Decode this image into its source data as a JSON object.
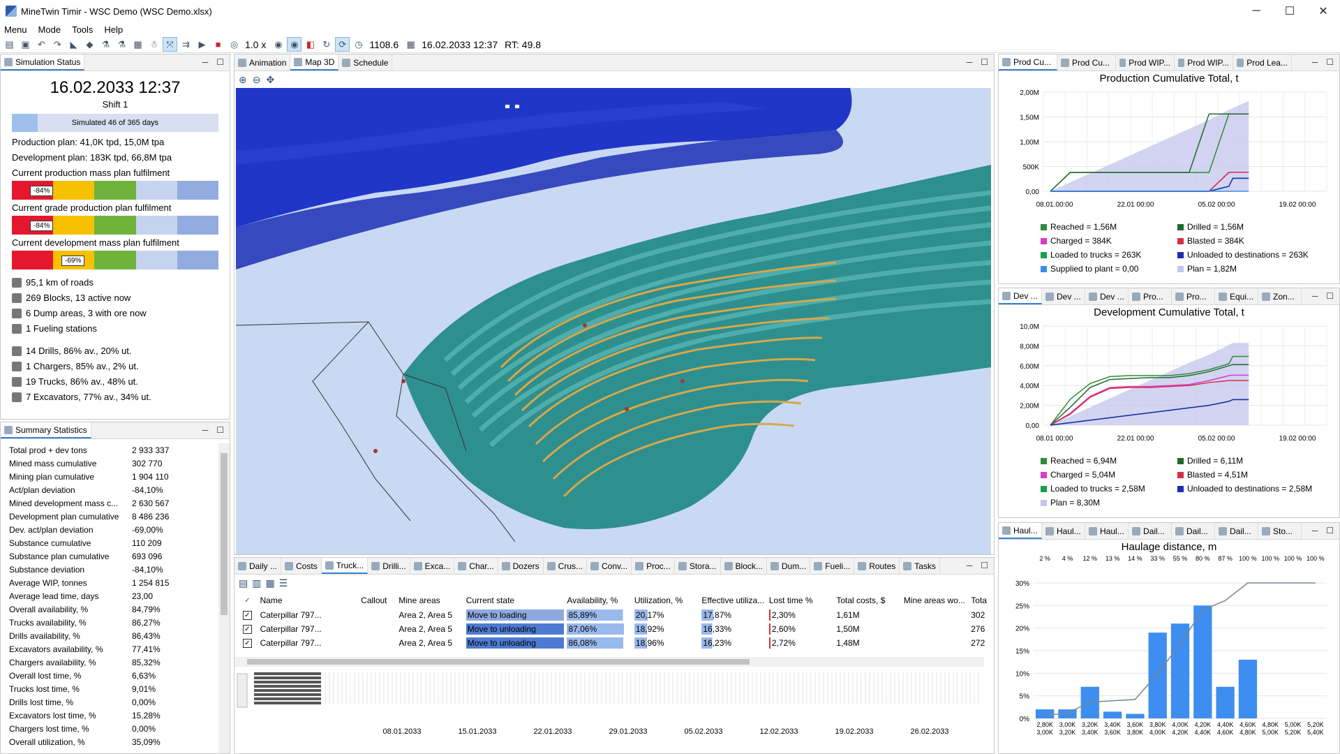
{
  "window": {
    "title": "MineTwin Timir - WSC Demo (WSC Demo.xlsx)"
  },
  "menu": [
    "Menu",
    "Mode",
    "Tools",
    "Help"
  ],
  "toolbar": {
    "speed": "1.0 x",
    "time_value": "1108.6",
    "datetime": "16.02.2033 12:37",
    "rt": "RT: 49.8"
  },
  "sim_status": {
    "tab": "Simulation Status",
    "date": "16.02.2033 12:37",
    "shift": "Shift 1",
    "simulated": "Simulated 46 of 365 days",
    "simulated_fraction": 0.126,
    "prod_plan": "Production plan: 41,0K tpd, 15,0M tpa",
    "dev_plan": "Development plan: 183K tpd, 66,8M tpa",
    "fulfilments": [
      {
        "label": "Current production mass plan fulfilment",
        "badge": "-84%",
        "fraction": 0.16
      },
      {
        "label": "Current grade production plan fulfilment",
        "badge": "-84%",
        "fraction": 0.16
      },
      {
        "label": "Current development mass plan fulfilment",
        "badge": "-69%",
        "fraction": 0.31
      }
    ],
    "infrastructure": [
      "95,1 km of roads",
      "269 Blocks, 13 active now",
      "6 Dump areas, 3 with ore now",
      "1 Fueling stations"
    ],
    "equipment": [
      "14 Drills, 86% av., 20% ut.",
      "1 Chargers, 85% av., 2% ut.",
      "19 Trucks, 86% av., 48% ut.",
      "7 Excavators, 77% av., 34% ut."
    ]
  },
  "summary": {
    "tab": "Summary Statistics",
    "rows": [
      [
        "Total prod + dev tons",
        "2 933 337"
      ],
      [
        "Mined mass cumulative",
        "302 770"
      ],
      [
        "Mining plan cumulative",
        "1 904 110"
      ],
      [
        "Act/plan deviation",
        "-84,10%"
      ],
      [
        "Mined development mass c...",
        "2 630 567"
      ],
      [
        "Development plan cumulative",
        "8 486 236"
      ],
      [
        "Dev. act/plan deviation",
        "-69,00%"
      ],
      [
        "Substance cumulative",
        "110 209"
      ],
      [
        "Substance plan cumulative",
        "693 096"
      ],
      [
        "Substance deviation",
        "-84,10%"
      ],
      [
        "Average WIP, tonnes",
        "1 254 815"
      ],
      [
        "Average lead time, days",
        "23,00"
      ],
      [
        "Overall availability, %",
        "84,79%"
      ],
      [
        "Trucks availability, %",
        "86,27%"
      ],
      [
        "Drills availability, %",
        "86,43%"
      ],
      [
        "Excavators availability, %",
        "77,41%"
      ],
      [
        "Chargers availability, %",
        "85,32%"
      ],
      [
        "Overall lost time, %",
        "6,63%"
      ],
      [
        "Trucks lost time, %",
        "9,01%"
      ],
      [
        "Drills lost time, %",
        "0,00%"
      ],
      [
        "Excavators lost time, %",
        "15,28%"
      ],
      [
        "Chargers lost time, %",
        "0,00%"
      ],
      [
        "Overall utilization, %",
        "35,09%"
      ]
    ]
  },
  "center_tabs": [
    "Animation",
    "Map 3D",
    "Schedule"
  ],
  "bottom_tabs": [
    "Daily ...",
    "Costs",
    "Truck...",
    "Drilli...",
    "Exca...",
    "Char...",
    "Dozers",
    "Crus...",
    "Conv...",
    "Proc...",
    "Stora...",
    "Block...",
    "Dum...",
    "Fueli...",
    "Routes",
    "Tasks"
  ],
  "truck_grid": {
    "columns": [
      "Name",
      "Callout",
      "Mine areas",
      "Current state",
      "Availability, %",
      "Utilization, %",
      "Effective utiliza...",
      "Lost time %",
      "Total costs, $",
      "Mine areas wo...",
      "Tota"
    ],
    "rows": [
      {
        "name": "Caterpillar 797...",
        "callout": "",
        "areas": "Area 2, Area 5",
        "state": "Move to loading",
        "avail": "85,89%",
        "avail_f": 0.859,
        "util": "20,17%",
        "util_f": 0.2017,
        "eff": "17,87%",
        "eff_f": 0.1787,
        "lost": "2,30%",
        "cost": "1,61M",
        "wo": "",
        "tot": "302"
      },
      {
        "name": "Caterpillar 797...",
        "callout": "",
        "areas": "Area 2, Area 5",
        "state": "Move to unloading",
        "avail": "87,06%",
        "avail_f": 0.8706,
        "util": "18,92%",
        "util_f": 0.1892,
        "eff": "16,33%",
        "eff_f": 0.1633,
        "lost": "2,60%",
        "cost": "1,50M",
        "wo": "",
        "tot": "276"
      },
      {
        "name": "Caterpillar 797...",
        "callout": "",
        "areas": "Area 2, Area 5",
        "state": "Move to unloading",
        "avail": "86,08%",
        "avail_f": 0.8608,
        "util": "18,96%",
        "util_f": 0.1896,
        "eff": "16,23%",
        "eff_f": 0.1623,
        "lost": "2,72%",
        "cost": "1,48M",
        "wo": "",
        "tot": "272"
      }
    ]
  },
  "gantt_dates": [
    "08.01.2033",
    "15.01.2033",
    "22.01.2033",
    "29.01.2033",
    "05.02.2033",
    "12.02.2033",
    "19.02.2033",
    "26.02.2033"
  ],
  "right_top_tabs": [
    "Prod Cu...",
    "Prod Cu...",
    "Prod WIP...",
    "Prod WIP...",
    "Prod Lea..."
  ],
  "right_mid_tabs": [
    "Dev ...",
    "Dev ...",
    "Dev ...",
    "Pro...",
    "Pro...",
    "Equi...",
    "Zon..."
  ],
  "right_bot_tabs": [
    "Haul...",
    "Haul...",
    "Haul...",
    "Dail...",
    "Dail...",
    "Dail...",
    "Sto..."
  ],
  "chart_data": [
    {
      "type": "line",
      "title": "Production Cumulative Total, t",
      "x_ticks": [
        "08.01.00:00",
        "22.01 00:00",
        "05.02 00:00",
        "19.02 00:00"
      ],
      "y_ticks": [
        "0,00",
        "500K",
        "1,00M",
        "1,50M",
        "2,00M"
      ],
      "ylim": [
        0,
        2000000
      ],
      "x": [
        0,
        5,
        10,
        15,
        20,
        25,
        30,
        35,
        40,
        45,
        46,
        50
      ],
      "series": [
        {
          "name": "Reached = 1,56M",
          "color": "#2e8b3a",
          "values": [
            0,
            380000,
            380000,
            380000,
            380000,
            380000,
            380000,
            380000,
            380000,
            1560000,
            1560000,
            1560000
          ]
        },
        {
          "name": "Drilled = 1,56M",
          "color": "#1e6a2a",
          "values": [
            0,
            380000,
            380000,
            380000,
            380000,
            380000,
            380000,
            380000,
            1560000,
            1560000,
            1560000,
            1560000
          ]
        },
        {
          "name": "Charged = 384K",
          "color": "#d63cc8",
          "values": [
            0,
            0,
            0,
            0,
            0,
            0,
            0,
            0,
            0,
            380000,
            384000,
            384000
          ]
        },
        {
          "name": "Blasted = 384K",
          "color": "#d43049",
          "values": [
            0,
            0,
            0,
            0,
            0,
            0,
            0,
            0,
            0,
            384000,
            384000,
            384000
          ]
        },
        {
          "name": "Loaded to trucks = 263K",
          "color": "#16a34a",
          "values": [
            0,
            0,
            0,
            0,
            0,
            0,
            0,
            0,
            0,
            100000,
            263000,
            263000
          ]
        },
        {
          "name": "Unloaded to destinations = 263K",
          "color": "#1b2fb0",
          "values": [
            0,
            0,
            0,
            0,
            0,
            0,
            0,
            0,
            0,
            100000,
            263000,
            263000
          ]
        },
        {
          "name": "Supplied to plant = 0,00",
          "color": "#3a8ee6",
          "values": [
            0,
            0,
            0,
            0,
            0,
            0,
            0,
            0,
            0,
            0,
            0,
            0
          ]
        },
        {
          "name": "Plan = 1,82M",
          "color": "#c3c6ec",
          "values": [
            0,
            180000,
            360000,
            540000,
            720000,
            900000,
            1080000,
            1260000,
            1440000,
            1640000,
            1680000,
            1820000
          ]
        }
      ]
    },
    {
      "type": "line",
      "title": "Development Cumulative Total, t",
      "x_ticks": [
        "08.01 00:00",
        "22.01 00:00",
        "05.02 00:00",
        "19.02 00:00"
      ],
      "y_ticks": [
        "0,00",
        "2,00M",
        "4,00M",
        "6,00M",
        "8,00M",
        "10,0M"
      ],
      "ylim": [
        0,
        10000000
      ],
      "x": [
        0,
        5,
        10,
        15,
        20,
        25,
        30,
        35,
        40,
        45,
        46,
        50
      ],
      "series": [
        {
          "name": "Reached = 6,94M",
          "color": "#2e8b3a",
          "values": [
            0,
            2600000,
            4200000,
            4900000,
            5000000,
            5000000,
            5000000,
            5200000,
            5600000,
            6200000,
            6940000,
            6940000
          ]
        },
        {
          "name": "Drilled = 6,11M",
          "color": "#1e6a2a",
          "values": [
            0,
            1800000,
            3800000,
            4600000,
            4700000,
            4800000,
            4800000,
            5000000,
            5400000,
            6000000,
            6110000,
            6110000
          ]
        },
        {
          "name": "Charged = 5,04M",
          "color": "#d63cc8",
          "values": [
            0,
            1200000,
            2900000,
            3800000,
            3900000,
            3900000,
            4000000,
            4100000,
            4500000,
            5000000,
            5040000,
            5040000
          ]
        },
        {
          "name": "Blasted = 4,51M",
          "color": "#d43049",
          "values": [
            0,
            1100000,
            2800000,
            3700000,
            3800000,
            3800000,
            3900000,
            4000000,
            4300000,
            4500000,
            4510000,
            4510000
          ]
        },
        {
          "name": "Loaded to trucks = 2,58M",
          "color": "#16a34a",
          "values": [
            0,
            250000,
            500000,
            750000,
            1000000,
            1250000,
            1500000,
            1750000,
            2000000,
            2400000,
            2580000,
            2580000
          ]
        },
        {
          "name": "Unloaded to destinations = 2,58M",
          "color": "#1b2fb0",
          "values": [
            0,
            250000,
            500000,
            750000,
            1000000,
            1250000,
            1500000,
            1750000,
            2000000,
            2400000,
            2580000,
            2580000
          ]
        },
        {
          "name": "Plan = 8,30M",
          "color": "#c3c6ec",
          "values": [
            0,
            900000,
            1800000,
            2700000,
            3600000,
            4500000,
            5400000,
            6300000,
            7100000,
            8100000,
            8300000,
            8300000
          ]
        }
      ]
    },
    {
      "type": "bar",
      "title": "Haulage distance, m",
      "categories_top": [
        "2,80K",
        "3,00K",
        "3,20K",
        "3,40K",
        "3,60K",
        "3,80K",
        "4,00K",
        "4,20K",
        "4,40K",
        "4,60K",
        "4,80K",
        "5,00K",
        "5,20K"
      ],
      "categories_bottom": [
        "3,00K",
        "3,20K",
        "3,40K",
        "3,60K",
        "3,80K",
        "4,00K",
        "4,20K",
        "4,40K",
        "4,60K",
        "4,80K",
        "5,00K",
        "5,20K",
        "5,40K"
      ],
      "cumulative_labels": [
        "2 %",
        "4 %",
        "12 %",
        "13 %",
        "14 %",
        "33 %",
        "55 %",
        "80 %",
        "87 %",
        "100 %",
        "100 %",
        "100 %",
        "100 %"
      ],
      "values": [
        2,
        2,
        7,
        1.5,
        1,
        19,
        21,
        25,
        7,
        13,
        0,
        0,
        0
      ],
      "cumulative": [
        2,
        4,
        12,
        13,
        14,
        33,
        55,
        80,
        87,
        100,
        100,
        100,
        100
      ],
      "y_ticks": [
        "0%",
        "5%",
        "10%",
        "15%",
        "20%",
        "25%",
        "30%"
      ],
      "ylim": [
        0,
        30
      ]
    }
  ]
}
